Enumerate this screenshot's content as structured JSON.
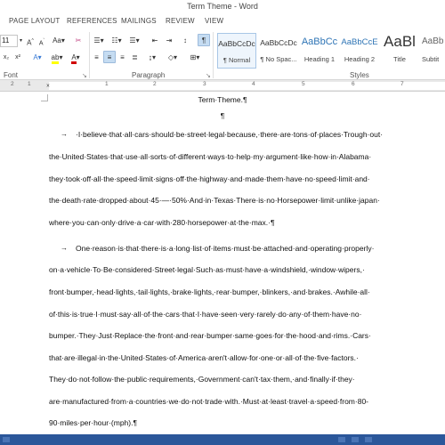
{
  "window": {
    "title": "Term Theme - Word"
  },
  "tabs": [
    {
      "label": "PAGE LAYOUT"
    },
    {
      "label": "REFERENCES"
    },
    {
      "label": "MAILINGS"
    },
    {
      "label": "REVIEW"
    },
    {
      "label": "VIEW"
    }
  ],
  "ribbon": {
    "font_size": "11",
    "groups": {
      "font": "Font",
      "paragraph": "Paragraph",
      "styles": "Styles"
    },
    "styles": [
      {
        "sample": "AaBbCcDc",
        "name": "¶ Normal"
      },
      {
        "sample": "AaBbCcDc",
        "name": "¶ No Spac..."
      },
      {
        "sample": "AaBbCc",
        "name": "Heading 1"
      },
      {
        "sample": "AaBbCcE",
        "name": "Heading 2"
      },
      {
        "sample": "AaBl",
        "name": "Title"
      },
      {
        "sample": "AaBb",
        "name": "Subtit"
      }
    ]
  },
  "ruler": {
    "numbers": [
      "2",
      "1",
      "1",
      "2",
      "3",
      "4",
      "5",
      "6",
      "7"
    ]
  },
  "document": {
    "title": "Term·Theme.¶",
    "empty_para": "¶",
    "tab_arrow": "→",
    "paragraph1": [
      "·I·believe·that·all·cars·should·be·street·legal·because,·there·are·tons·of·places·Trough·out·",
      "the·United·States·that·use·all·sorts·of·different·ways·to·help·my·argument·like·how·in·Alabama·",
      "they·took·off·all·the·speed·limit·signs·off·the·highway·and·made·them·have·no·speed·limit·and·",
      "the·death·rate·dropped·about·45·—·50%·And·in·Texas·There·is·no·Horsepower·limit·unlike·japan·",
      "where·you·can·only·drive·a·car·with·280·horsepower·at·the·max.·¶"
    ],
    "paragraph2": [
      "One·reason·is·that·there·is·a·long·list·of·items·must·be·attached·and·operating·properly·",
      "on·a·vehicle·To·Be·considered·Street·legal·Such·as·must·have·a·windshield,·window·wipers,·",
      "front·bumper,·head·lights,·tail·lights,·brake·lights,·rear·bumper,·blinkers,·and·brakes.·Awhile·all·",
      "of·this·is·true·I·must·say·all·of·the·cars·that·I·have·seen·very·rarely·do·any·of·them·have·no·",
      "bumper.·They·Just·Replace·the·front·and·rear·bumper·same·goes·for·the·hood·and·rims.·Cars·",
      "that·are·illegal·in·the·United·States·of·America·aren't·allow·for·one·or·all·of·the·five·factors.·",
      "They·do·not·follow·the·public·requirements,·Government·can't·tax·them,·and·finally·if·they·",
      "are·manufactured·from·a·countries·we·do·not·trade·with.·Must·at·least·travel·a·speed·from·80-",
      "90·miles·per·hour·(mph).¶"
    ]
  }
}
